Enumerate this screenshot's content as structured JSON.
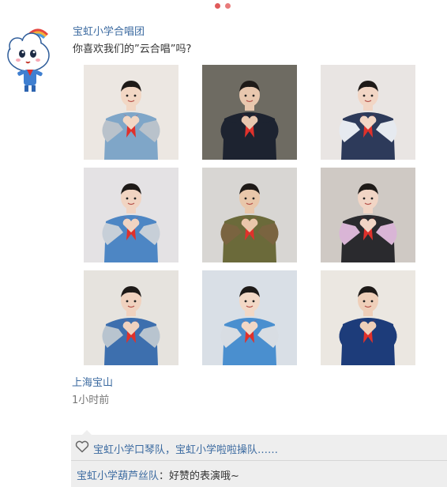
{
  "post": {
    "author": "宝虹小学合唱团",
    "text": "你喜欢我们的”云合唱”吗?",
    "location": "上海宝山",
    "time": "1小时前"
  },
  "photos": [
    {
      "name": "photo-1",
      "bg": "#ece7e2",
      "jacket": "#7fa6c8",
      "sleeve": "#b9c2cb",
      "face": "#f2d7c4"
    },
    {
      "name": "photo-2",
      "bg": "#6e6b62",
      "jacket": "#1d2330",
      "sleeve": "#1d2330",
      "face": "#e8c7ae"
    },
    {
      "name": "photo-3",
      "bg": "#e9e5e3",
      "jacket": "#2d3a5a",
      "sleeve": "#e6eaf0",
      "face": "#f2d6c5"
    },
    {
      "name": "photo-4",
      "bg": "#e4e2e4",
      "jacket": "#4d86c4",
      "sleeve": "#c7cfd8",
      "face": "#f1d4c2"
    },
    {
      "name": "photo-5",
      "bg": "#d8d6d3",
      "jacket": "#6b6a3a",
      "sleeve": "#7a6440",
      "face": "#e9c7aa"
    },
    {
      "name": "photo-6",
      "bg": "#cfc9c4",
      "jacket": "#2a2a2e",
      "sleeve": "#d9b5d6",
      "face": "#f1d5c5"
    },
    {
      "name": "photo-7",
      "bg": "#e6e3de",
      "jacket": "#3d6fae",
      "sleeve": "#b8c4cf",
      "face": "#f0d2bf"
    },
    {
      "name": "photo-8",
      "bg": "#d9dfe6",
      "jacket": "#4a8fcf",
      "sleeve": "#d8dde3",
      "face": "#f2d8c6"
    },
    {
      "name": "photo-9",
      "bg": "#ebe7e1",
      "jacket": "#1d3c7a",
      "sleeve": "#1d3c7a",
      "face": "#efcfb9"
    }
  ],
  "likes": {
    "icon": "heart-outline-icon",
    "text": "宝虹小学口琴队，宝虹小学啦啦操队……"
  },
  "comment": {
    "author": "宝虹小学葫芦丝队",
    "separator": "：",
    "text": "好赞的表演哦~"
  },
  "colors": {
    "link": "#3b6aa0",
    "scarf": "#e0312b",
    "comment_bg": "#eeeeee"
  }
}
